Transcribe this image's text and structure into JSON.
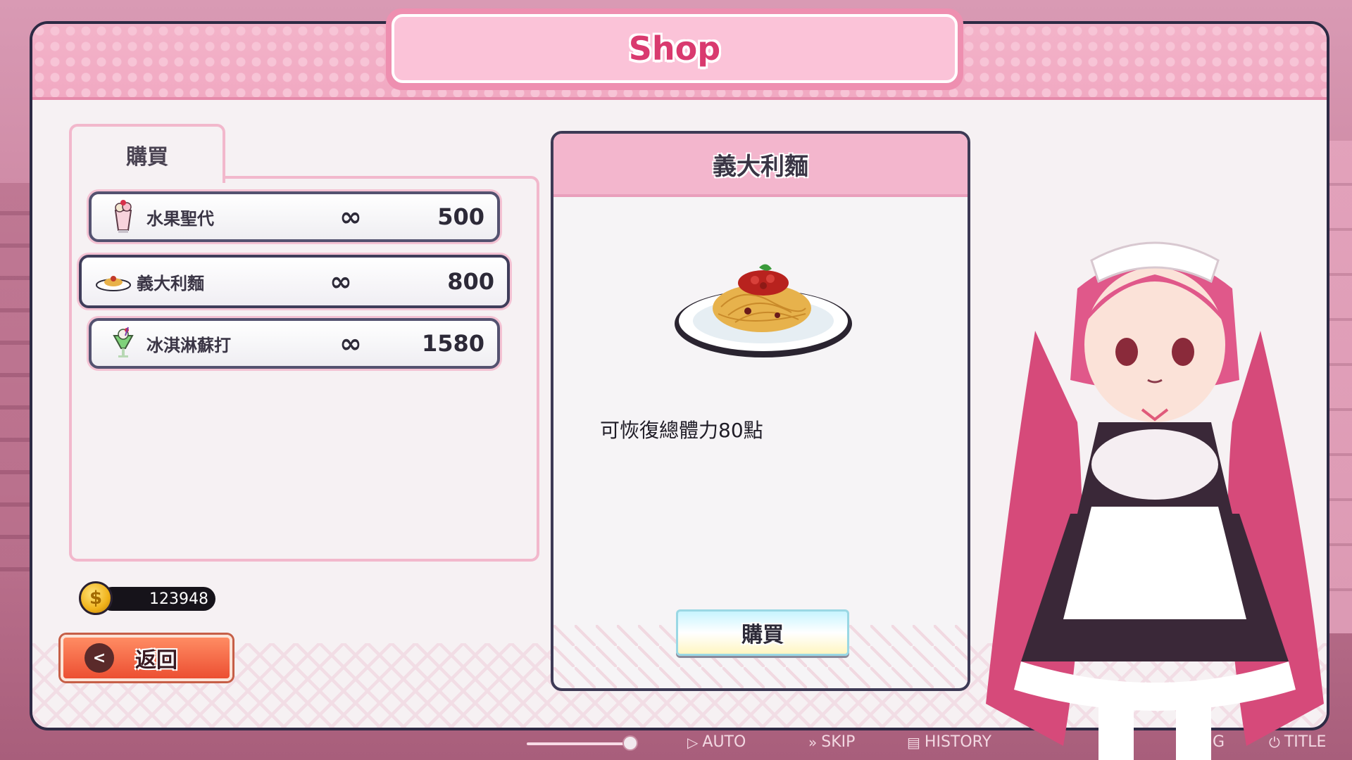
{
  "window": {
    "title": "Shop"
  },
  "tab": {
    "label": "購買"
  },
  "items": [
    {
      "name": "水果聖代",
      "stock": "∞",
      "price": "500",
      "icon": "sundae-icon"
    },
    {
      "name": "義大利麵",
      "stock": "∞",
      "price": "800",
      "icon": "spaghetti-icon",
      "selected": true
    },
    {
      "name": "冰淇淋蘇打",
      "stock": "∞",
      "price": "1580",
      "icon": "cream-soda-icon"
    }
  ],
  "wallet": {
    "amount": "123948",
    "icon": "gold-coin-icon"
  },
  "back_button": {
    "label": "返回",
    "icon": "back-arrow-icon"
  },
  "detail": {
    "title": "義大利麵",
    "description": "可恢復總體力80點",
    "buy_label": "購買",
    "image": "spaghetti-plate-icon"
  },
  "system_bar": {
    "auto": "AUTO",
    "skip": "SKIP",
    "history": "HISTORY",
    "config_partial": "G",
    "title": "TITLE"
  },
  "colors": {
    "accent_pink": "#f3b6cd",
    "title_text": "#d93a6f",
    "frame_border": "#2d2a44",
    "back_button": "#ec4f32"
  }
}
